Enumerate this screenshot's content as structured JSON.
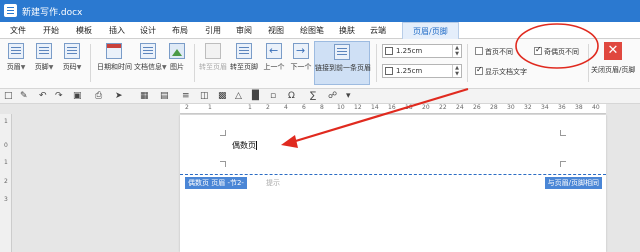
{
  "window": {
    "title": "新建写作.docx"
  },
  "menu": {
    "items": [
      "文件",
      "开始",
      "模板",
      "插入",
      "设计",
      "布局",
      "引用",
      "审阅",
      "视图",
      "绘图笔",
      "换肤",
      "云端"
    ],
    "active_tab": "页眉/页脚"
  },
  "ribbon": {
    "header": "页眉",
    "footer": "页脚",
    "page_number": "页码",
    "datetime": "日期和时间",
    "doc_info": "文档信息",
    "picture": "图片",
    "goto_header": "转至页眉",
    "goto_footer": "转至页脚",
    "prev": "上一个",
    "next": "下一个",
    "link_prev": "链接到前一条页眉",
    "header_distance": "1.25cm",
    "footer_distance": "1.25cm",
    "first_page_diff": "首页不同",
    "odd_even_diff": "奇偶页不同",
    "show_doc_text": "显示文档文字",
    "close": "关闭页眉/页脚"
  },
  "document": {
    "header_text": "偶数页",
    "header_tag": "偶数页 页眉 -节2-",
    "hint": "提示",
    "same_as_prev": "与页眉/页脚相同"
  },
  "ruler": {
    "h_numbers": [
      "2",
      "1",
      "1",
      "2",
      "4",
      "6",
      "8",
      "10",
      "12",
      "14",
      "16",
      "18",
      "20",
      "22",
      "24",
      "26",
      "28",
      "30",
      "32",
      "34",
      "36",
      "38",
      "40"
    ],
    "v_numbers": [
      "1",
      "0",
      "1",
      "2",
      "3"
    ]
  },
  "annotation": {
    "circle_color": "#e02a1f",
    "arrow_color": "#e02a1f"
  },
  "colors": {
    "titlebar": "#2b79d0",
    "accent": "#1f6bc6",
    "close": "#e0483f"
  }
}
